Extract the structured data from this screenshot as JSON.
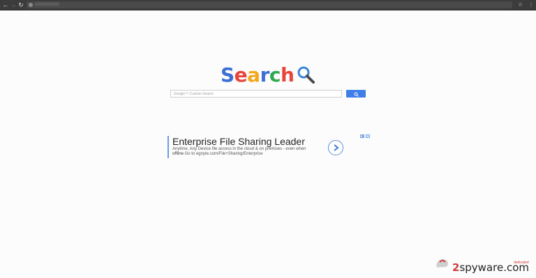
{
  "browser": {
    "back_icon": "back-arrow-icon",
    "forward_icon": "forward-arrow-icon",
    "reload_icon": "reload-icon",
    "star_icon": "star-icon",
    "menu_icon": "kebab-menu-icon"
  },
  "logo": {
    "letters": [
      "S",
      "e",
      "a",
      "r",
      "c",
      "h"
    ],
    "colors": [
      "#3b6fd6",
      "#e8453c",
      "#f2a81d",
      "#3b6fd6",
      "#2fa84f",
      "#e8453c"
    ],
    "icon": "magnifier-icon"
  },
  "search": {
    "placeholder": "Google™ Custom Search",
    "button_icon": "search-icon",
    "button_color": "#3f7ee8"
  },
  "ad": {
    "title": "Enterprise File Sharing Leader",
    "description": "Anytime, Any Device file access in the cloud & on premises - even when",
    "offline": "offline",
    "url": "Go to egnyte.com/File+Sharing/Enterprise",
    "arrow_icon": "chevron-right-icon",
    "adchoices_icon": "adchoices-icon"
  },
  "watermark": {
    "brand_number": "2",
    "brand": "spyware",
    "tld": ".com",
    "tagline": "dedicated"
  }
}
